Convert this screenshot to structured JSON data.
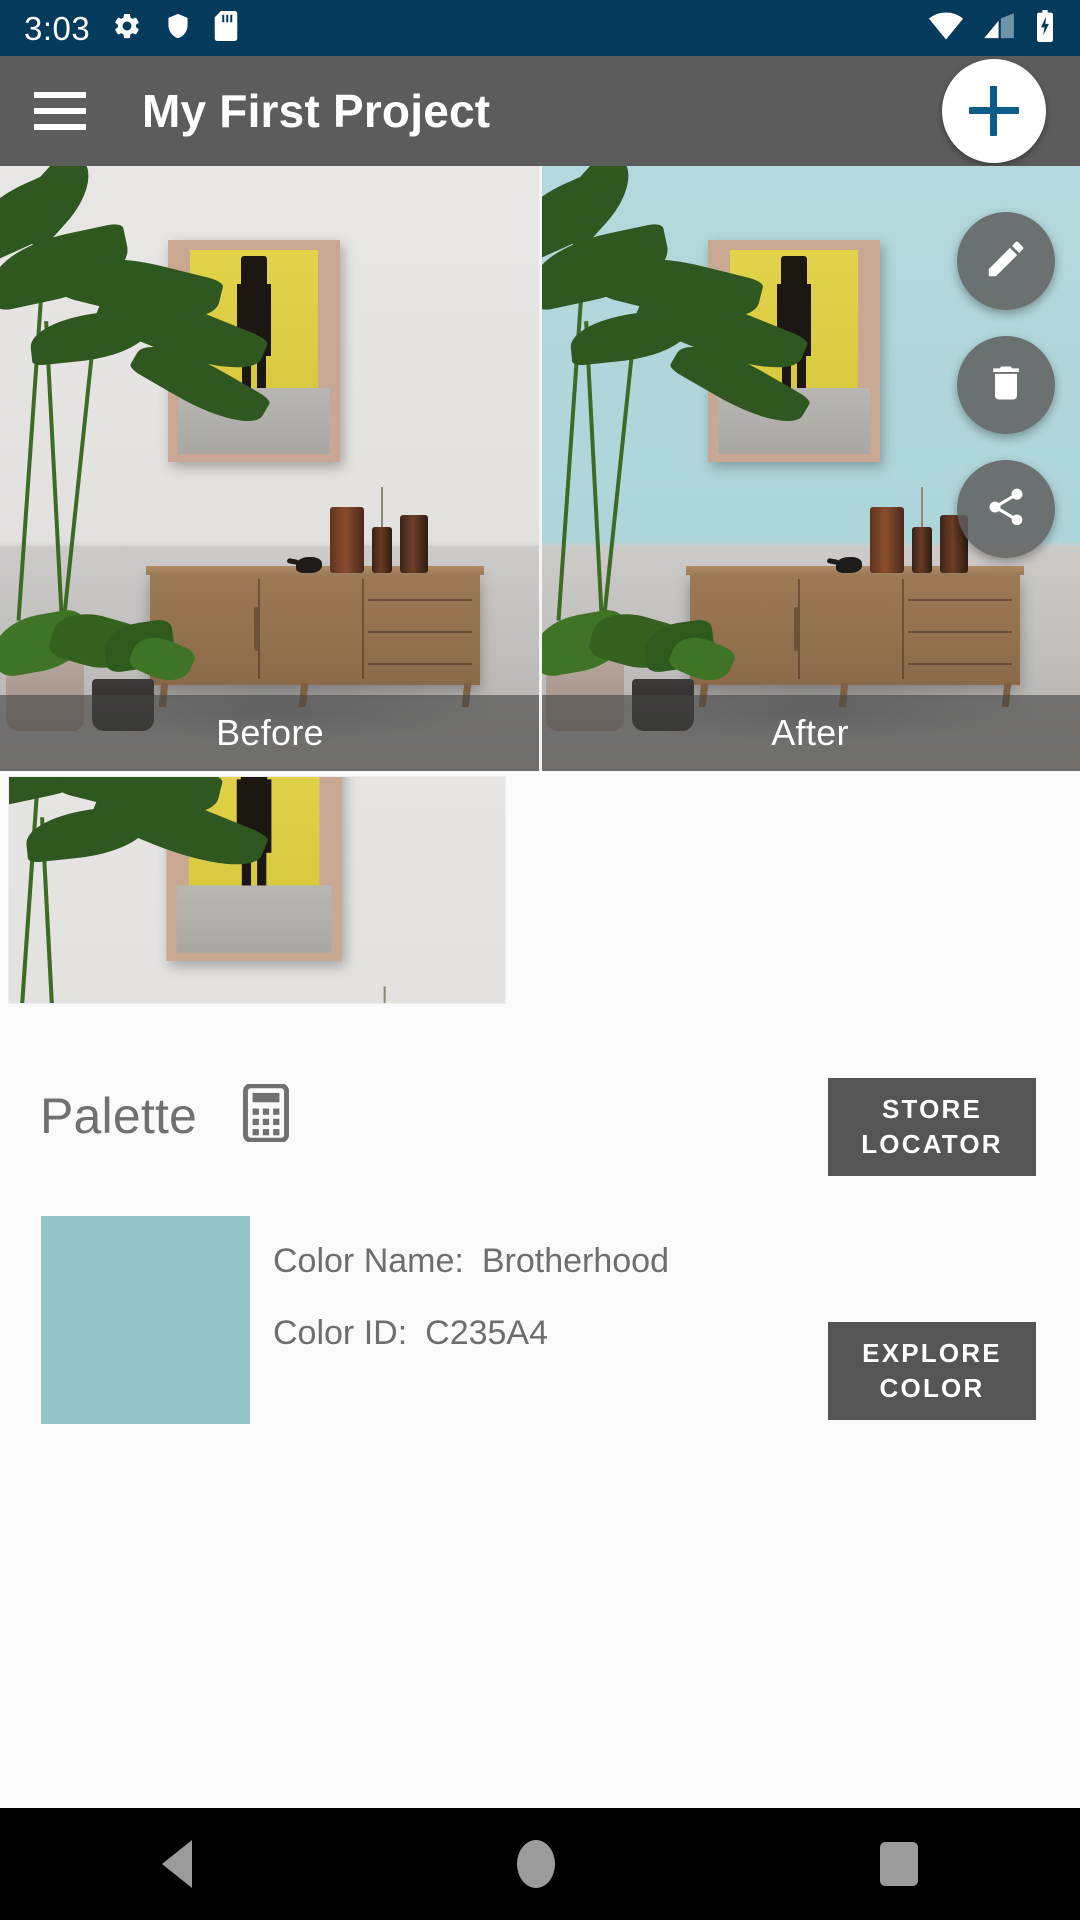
{
  "status_bar": {
    "time": "3:03",
    "left_icons": [
      "gear-icon",
      "shield-icon",
      "sd-card-icon"
    ],
    "right_icons": [
      "wifi-icon",
      "cellular-signal-icon",
      "battery-charging-icon"
    ],
    "background_color": "#043a5c"
  },
  "app_bar": {
    "menu_icon": "hamburger-menu-icon",
    "title": "My First Project",
    "add_button_icon": "plus-icon",
    "background_color": "#5c5c5c",
    "accent_color": "#0b5c86"
  },
  "compare": {
    "before_label": "Before",
    "after_label": "After",
    "before_wall_color": "#e3e1df",
    "after_wall_color": "#aed5da",
    "actions": [
      {
        "name": "edit",
        "icon": "pencil-icon"
      },
      {
        "name": "delete",
        "icon": "trash-icon"
      },
      {
        "name": "share",
        "icon": "share-icon"
      }
    ]
  },
  "palette": {
    "title": "Palette",
    "calculator_icon": "calculator-icon",
    "store_locator_button": {
      "line1": "STORE",
      "line2": "LOCATOR"
    },
    "explore_color_button": {
      "line1": "EXPLORE",
      "line2": "COLOR"
    },
    "swatch_color": "#95c5cb",
    "rows": [
      {
        "label": "Color Name:",
        "value": "Brotherhood"
      },
      {
        "label": "Color ID:",
        "value": "C235A4"
      }
    ]
  },
  "nav_bar": {
    "back_icon": "back-triangle-icon",
    "home_icon": "home-circle-icon",
    "recents_icon": "recents-square-icon",
    "background_color": "#000000"
  }
}
